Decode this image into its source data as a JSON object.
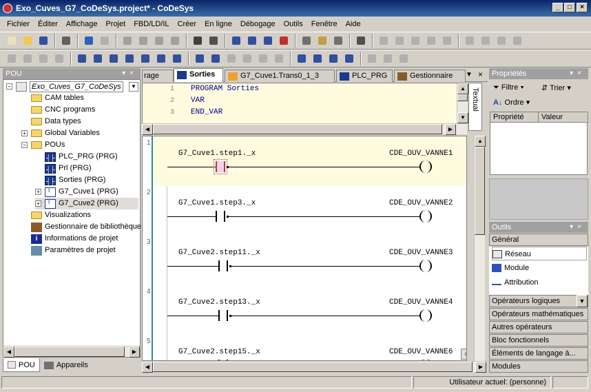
{
  "window": {
    "title": "Exo_Cuves_G7_CoDeSys.project* - CoDeSys"
  },
  "menu": [
    "Fichier",
    "Éditer",
    "Affichage",
    "Projet",
    "FBD/LD/IL",
    "Créer",
    "En ligne",
    "Débogage",
    "Outils",
    "Fenêtre",
    "Aide"
  ],
  "pou_panel": {
    "title": "POU",
    "project_name": "Exo_Cuves_G7_CoDeSys",
    "items": [
      {
        "label": "CAM tables"
      },
      {
        "label": "CNC programs"
      },
      {
        "label": "Data types"
      },
      {
        "label": "Global Variables"
      },
      {
        "label": "POUs"
      },
      {
        "label": "PLC_PRG (PRG)"
      },
      {
        "label": "Prl (PRG)"
      },
      {
        "label": "Sorties (PRG)"
      },
      {
        "label": "G7_Cuve1 (PRG)"
      },
      {
        "label": "G7_Cuve2 (PRG)"
      },
      {
        "label": "Visualizations"
      },
      {
        "label": "Gestionnaire de bibliothèque"
      },
      {
        "label": "Informations de projet"
      },
      {
        "label": "Paramètres de projet"
      }
    ],
    "tabs": [
      "POU",
      "Appareils"
    ]
  },
  "editor": {
    "tabs": [
      "rage",
      "Sorties",
      "G7_Cuve1.Trans0_1_3",
      "PLC_PRG",
      "Gestionnaire"
    ],
    "side_tab": "Textual",
    "declaration": [
      {
        "line": "1",
        "text": "PROGRAM Sorties"
      },
      {
        "line": "2",
        "text": "VAR"
      },
      {
        "line": "3",
        "text": "END_VAR"
      }
    ],
    "networks": [
      {
        "num": "1",
        "contact": "G7_Cuve1.step1._x",
        "coil": "CDE_OUV_VANNE1"
      },
      {
        "num": "2",
        "contact": "G7_Cuve1.step3._x",
        "coil": "CDE_OUV_VANNE2"
      },
      {
        "num": "3",
        "contact": "G7_Cuve2.step11._x",
        "coil": "CDE_OUV_VANNE3"
      },
      {
        "num": "4",
        "contact": "G7_Cuve2.step13._x",
        "coil": "CDE_OUV_VANNE4"
      },
      {
        "num": "5",
        "contact": "G7_Cuve2.step15._x",
        "coil": "CDE_OUV_VANNE6"
      }
    ]
  },
  "properties": {
    "title": "Propriétés",
    "filter": "Filtre",
    "sort": "Trier",
    "order": "Ordre",
    "columns": [
      "Propriété",
      "Valeur"
    ]
  },
  "tools": {
    "title": "Outils",
    "general": "Général",
    "items": [
      "Réseau",
      "Module",
      "Attribution"
    ],
    "categories": [
      "Opérateurs logiques",
      "Opérateurs mathématiques",
      "Autres opérateurs",
      "Bloc fonctionnels",
      "Éléments de langage à...",
      "Modules"
    ]
  },
  "status": {
    "user": "Utilisateur actuel: (personne)"
  }
}
